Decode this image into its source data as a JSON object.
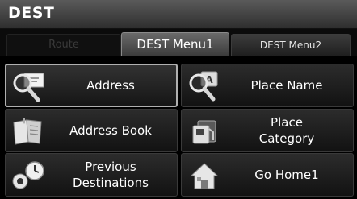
{
  "header": {
    "title": "DEST"
  },
  "tabs": [
    {
      "label": "Route",
      "state": "disabled"
    },
    {
      "label": "DEST Menu1",
      "state": "selected"
    },
    {
      "label": "DEST Menu2",
      "state": "normal"
    }
  ],
  "menu": {
    "address": {
      "label": "Address",
      "icon": "magnifier-envelope-icon"
    },
    "place_name": {
      "label": "Place Name",
      "icon": "magnifier-letters-icon"
    },
    "address_book": {
      "label": "Address Book",
      "icon": "open-book-icon"
    },
    "place_category": {
      "line1": "Place",
      "line2": "Category",
      "icon": "gas-pump-icon"
    },
    "previous_destinations": {
      "line1": "Previous",
      "line2": "Destinations",
      "icon": "clock-history-icon"
    },
    "go_home": {
      "label": "Go Home1",
      "icon": "home-icon"
    }
  }
}
